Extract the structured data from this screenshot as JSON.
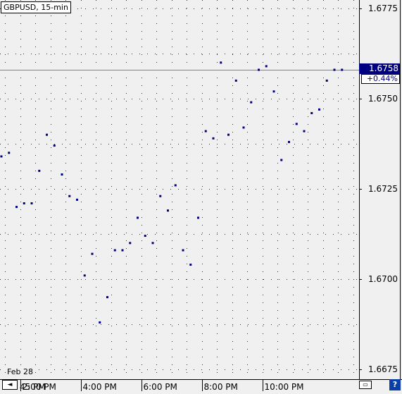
{
  "symbol_label": "GBPUSD, 15-min",
  "current_price": "1.6758",
  "change_pct": "+0.44%",
  "date_label": "Feb 28",
  "scroll_left_label": "◄",
  "scroll_mid_label": "≤",
  "link_icon": "link-icon",
  "help_label": "?",
  "colors": {
    "background": "#f0f0f0",
    "point": "#000080",
    "grid": "#303030",
    "price_line": "#808080"
  },
  "chart_data": {
    "type": "scatter",
    "title": "",
    "xlabel": "",
    "ylabel": "",
    "ylim": [
      1.6674,
      1.6776
    ],
    "y_ticks": [
      "1.6775",
      "1.6750",
      "1.6725",
      "1.6700",
      "1.6675"
    ],
    "x_ticks": [
      {
        "label": "45 PM",
        "x": 0.25
      },
      {
        "label": "2:00 PM",
        "x": 2.5
      },
      {
        "label": "4:00 PM",
        "x": 10.5
      },
      {
        "label": "6:00 PM",
        "x": 18.5
      },
      {
        "label": "8:00 PM",
        "x": 26.5
      },
      {
        "label": "10:00 PM",
        "x": 34.5
      }
    ],
    "grid": true,
    "current_line": 1.6758,
    "x": [
      0,
      1,
      2,
      3,
      4,
      5,
      6,
      7,
      8,
      9,
      10,
      11,
      12,
      13,
      14,
      15,
      16,
      17,
      18,
      19,
      20,
      21,
      22,
      23,
      24,
      25,
      26,
      27,
      28,
      29,
      30,
      31,
      32,
      33,
      34,
      35,
      36,
      37,
      38,
      39,
      40,
      41,
      42,
      43,
      44,
      45
    ],
    "y": [
      1.6734,
      1.6735,
      1.672,
      1.6721,
      1.6721,
      1.673,
      1.674,
      1.6737,
      1.6729,
      1.6723,
      1.6722,
      1.6701,
      1.6707,
      1.6688,
      1.6695,
      1.6708,
      1.6708,
      1.671,
      1.6717,
      1.6712,
      1.671,
      1.6723,
      1.6719,
      1.6726,
      1.6708,
      1.6704,
      1.6717,
      1.6741,
      1.6739,
      1.676,
      1.674,
      1.6755,
      1.6742,
      1.6749,
      1.6758,
      1.6759,
      1.6752,
      1.6733,
      1.6738,
      1.6743,
      1.6741,
      1.6746,
      1.6747,
      1.6755,
      1.6758,
      1.6758
    ]
  }
}
